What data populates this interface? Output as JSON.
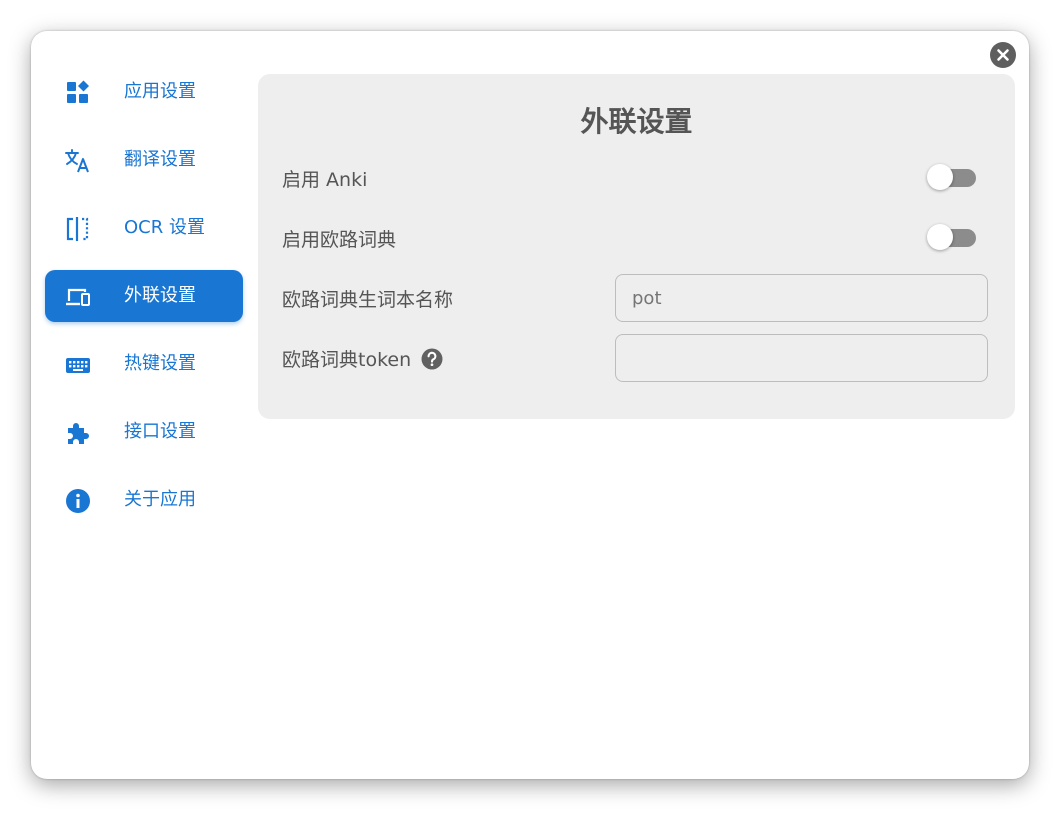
{
  "sidebar": {
    "items": [
      {
        "label": "应用设置",
        "icon": "app-settings-icon",
        "active": false
      },
      {
        "label": "翻译设置",
        "icon": "translate-icon",
        "active": false
      },
      {
        "label": "OCR 设置",
        "icon": "ocr-icon",
        "active": false
      },
      {
        "label": "外联设置",
        "icon": "devices-icon",
        "active": true
      },
      {
        "label": "热键设置",
        "icon": "keyboard-icon",
        "active": false
      },
      {
        "label": "接口设置",
        "icon": "puzzle-icon",
        "active": false
      },
      {
        "label": "关于应用",
        "icon": "info-icon",
        "active": false
      }
    ]
  },
  "panel": {
    "title": "外联设置",
    "enable_anki": {
      "label": "启用 Anki",
      "enabled": false
    },
    "enable_eudic": {
      "label": "启用欧路词典",
      "enabled": false
    },
    "eudic_category": {
      "label": "欧路词典生词本名称",
      "placeholder": "pot"
    },
    "eudic_token": {
      "label": "欧路词典token",
      "value": ""
    }
  },
  "colors": {
    "accent": "#1976d2",
    "panel_bg": "#eeeeee",
    "text": "#555555",
    "switch_track": "#8c8c8c"
  }
}
